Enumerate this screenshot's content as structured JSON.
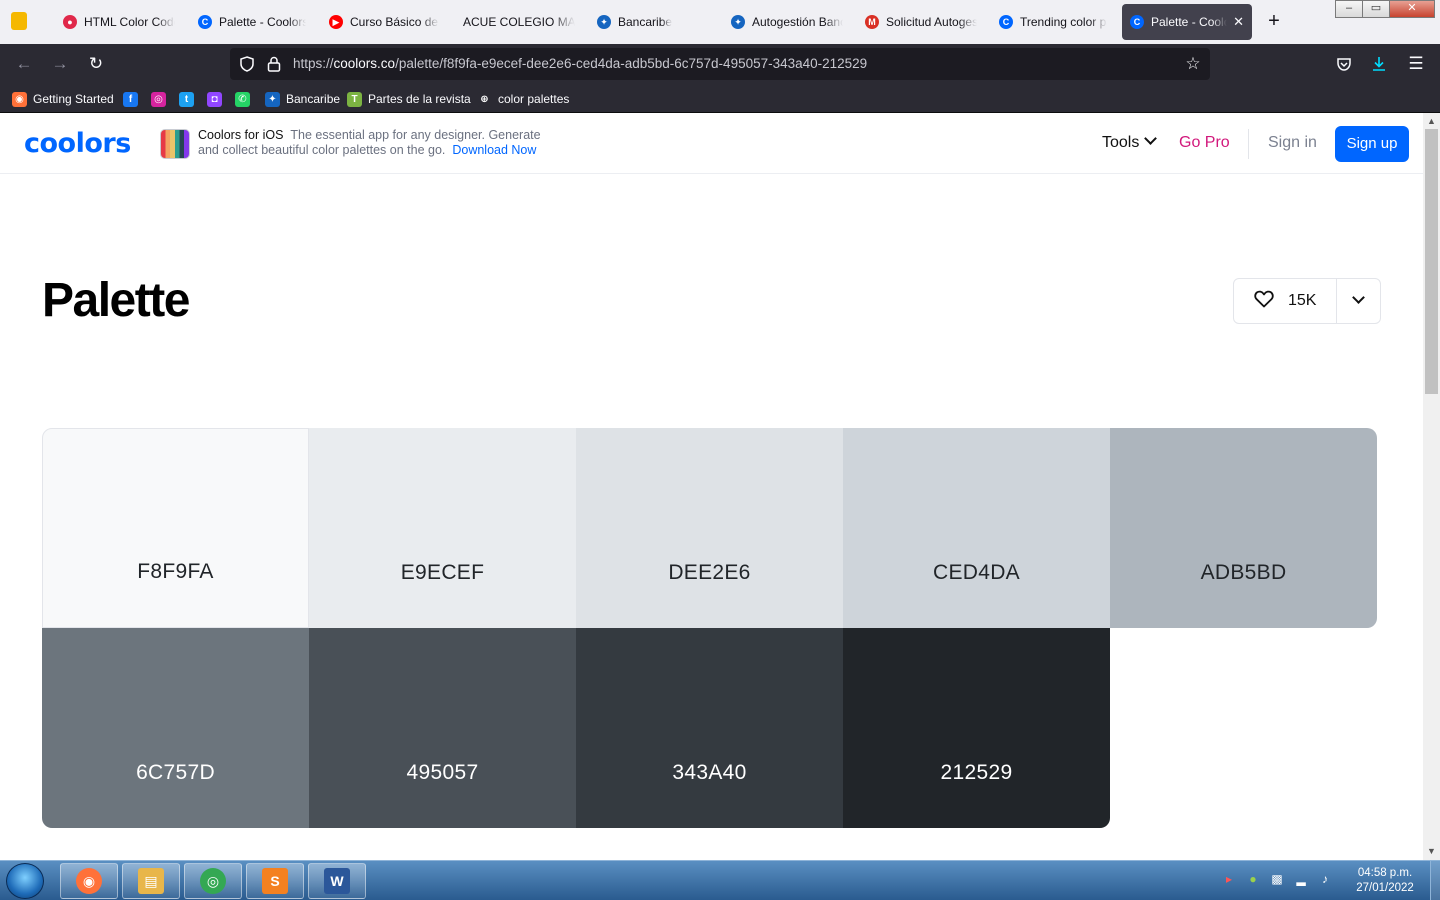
{
  "browser": {
    "tabs": [
      {
        "label": "HTML Color Codes",
        "icon": "html-color-codes-favicon",
        "color": "#e0284a",
        "glyph": "●"
      },
      {
        "label": "Palette - Coolors",
        "icon": "coolors-favicon",
        "color": "#0066ff",
        "glyph": "C"
      },
      {
        "label": "Curso Básico de Canva",
        "icon": "youtube-favicon",
        "color": "#ff0000",
        "glyph": "▶"
      },
      {
        "label": "ACUE COLEGIO MARIA",
        "icon": "",
        "color": "",
        "glyph": ""
      },
      {
        "label": "Bancaribe",
        "icon": "bancaribe-favicon",
        "color": "#1565c0",
        "glyph": "✦"
      },
      {
        "label": "Autogestión Bancaribe",
        "icon": "bancaribe-favicon",
        "color": "#1565c0",
        "glyph": "✦"
      },
      {
        "label": "Solicitud Autogestión",
        "icon": "gmail-favicon",
        "color": "#d93025",
        "glyph": "M"
      },
      {
        "label": "Trending color palettes",
        "icon": "coolors-favicon",
        "color": "#0066ff",
        "glyph": "C"
      },
      {
        "label": "Palette - Coolors",
        "icon": "coolors-favicon",
        "color": "#0066ff",
        "glyph": "C",
        "active": true
      }
    ],
    "new_tab_symbol": "+",
    "window_buttons": {
      "minimize": "–",
      "maximize": "▭",
      "close": "✕"
    },
    "url": {
      "scheme": "https://",
      "host": "coolors.co",
      "path": "/palette/f8f9fa-e9ecef-dee2e6-ced4da-adb5bd-6c757d-495057-343a40-212529"
    },
    "nav_icons": [
      "back-arrow-icon",
      "forward-arrow-icon",
      "reload-icon",
      "shield-icon",
      "lock-icon",
      "bookmark-star-icon",
      "pocket-icon",
      "download-icon",
      "menu-icon"
    ],
    "bookmarks": [
      {
        "label": "Getting Started",
        "icon": "firefox-icon",
        "color": "#ff7139",
        "glyph": "◉"
      },
      {
        "label": "",
        "icon": "facebook-icon",
        "color": "#1877f2",
        "glyph": "f"
      },
      {
        "label": "",
        "icon": "instagram-icon",
        "color": "#d6249f",
        "glyph": "◎"
      },
      {
        "label": "",
        "icon": "twitter-icon",
        "color": "#1da1f2",
        "glyph": "t"
      },
      {
        "label": "",
        "icon": "twitch-icon",
        "color": "#9146ff",
        "glyph": "◘"
      },
      {
        "label": "",
        "icon": "whatsapp-icon",
        "color": "#25d366",
        "glyph": "✆"
      },
      {
        "label": "Bancaribe",
        "icon": "bancaribe-icon",
        "color": "#1565c0",
        "glyph": "✦"
      },
      {
        "label": "Partes de la revista",
        "icon": "t-icon",
        "color": "#7cb342",
        "glyph": "T"
      },
      {
        "label": "color palettes",
        "icon": "globe-icon",
        "color": "#2b2a33",
        "glyph": "⊕"
      }
    ]
  },
  "site": {
    "logo": "coolors",
    "promo": {
      "title": "Coolors for iOS",
      "text_line1": "The essential app for any designer. Generate",
      "text_line2": "and collect beautiful color palettes on the go.",
      "link": "Download Now"
    },
    "nav": {
      "tools": "Tools",
      "gopro": "Go Pro",
      "signin": "Sign in",
      "signup": "Sign up"
    },
    "colors": {
      "brand": "#0066ff",
      "gopro": "#d2187c"
    }
  },
  "palette": {
    "title": "Palette",
    "likes": "15K",
    "colors": [
      {
        "hex": "F8F9FA",
        "color": "#f8f9fa",
        "text": "#212529"
      },
      {
        "hex": "E9ECEF",
        "color": "#e9ecef",
        "text": "#212529"
      },
      {
        "hex": "DEE2E6",
        "color": "#dee2e6",
        "text": "#212529"
      },
      {
        "hex": "CED4DA",
        "color": "#ced4da",
        "text": "#212529"
      },
      {
        "hex": "ADB5BD",
        "color": "#adb5bd",
        "text": "#212529"
      },
      {
        "hex": "6C757D",
        "color": "#6c757d",
        "text": "#ffffff"
      },
      {
        "hex": "495057",
        "color": "#495057",
        "text": "#ffffff"
      },
      {
        "hex": "343A40",
        "color": "#343a40",
        "text": "#ffffff"
      },
      {
        "hex": "212529",
        "color": "#212529",
        "text": "#ffffff"
      }
    ]
  },
  "taskbar": {
    "apps": [
      {
        "name": "firefox-taskbar",
        "color": "#ff7139",
        "glyph": "◉"
      },
      {
        "name": "file-explorer-taskbar",
        "color": "#e8b64a",
        "glyph": "▤"
      },
      {
        "name": "chrome-taskbar",
        "color": "#34a853",
        "glyph": "◎"
      },
      {
        "name": "sublime-text-taskbar",
        "color": "#f48120",
        "glyph": "S"
      },
      {
        "name": "word-taskbar",
        "color": "#2b579a",
        "glyph": "W"
      }
    ],
    "clock": {
      "time": "04:58 p.m.",
      "date": "27/01/2022"
    }
  }
}
